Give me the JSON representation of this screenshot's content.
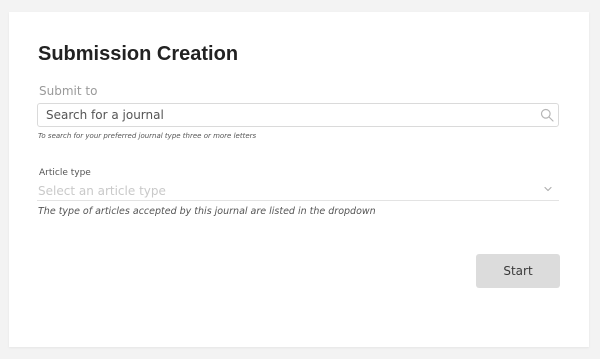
{
  "page": {
    "title": "Submission Creation"
  },
  "submit_to": {
    "label": "Submit to",
    "placeholder": "Search for a journal",
    "icon": "search-icon",
    "hint": "To search for your preferred journal type three or more letters"
  },
  "article_type": {
    "label": "Article type",
    "placeholder": "Select an article type",
    "icon": "chevron-down-icon",
    "hint": "The type of articles accepted by this journal are listed in the dropdown"
  },
  "actions": {
    "start_label": "Start"
  },
  "colors": {
    "background": "#f3f3f3",
    "card": "#ffffff",
    "button": "#dcdcdc",
    "border": "#dadada",
    "title": "#222222"
  }
}
